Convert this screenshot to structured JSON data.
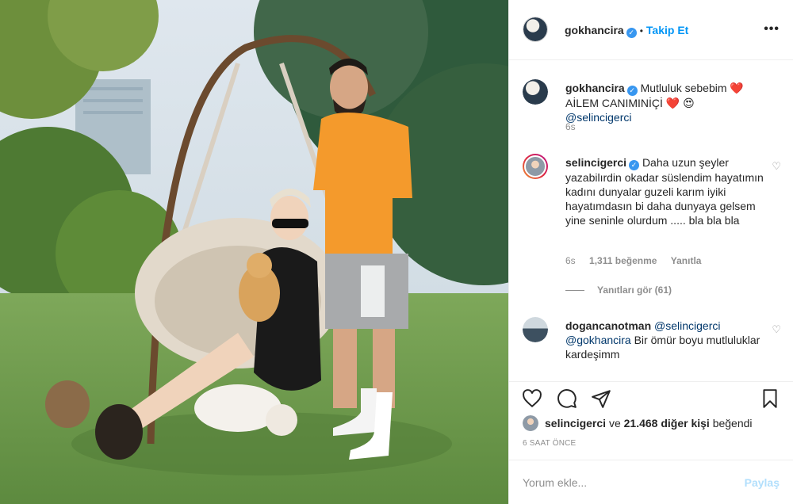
{
  "post_owner": {
    "username": "gokhancira",
    "follow_label": "Takip Et",
    "separator": "•"
  },
  "caption": {
    "username": "gokhancira",
    "text": "Mutluluk sebebim ❤️ AİLEM CANIMINİÇİ ❤️ 😍",
    "mention": "@selincigerci",
    "time": "6s"
  },
  "comments": [
    {
      "username": "selincigerci",
      "verified": true,
      "text": "Daha uzun şeyler yazabilırdin okadar süslendim hayatımın kadını dunyalar guzeli karım iyiki hayatımdasın bi daha dunyaya gelsem yine seninle olurdum ..... bla bla bla",
      "time": "6s",
      "likes": "1,311 beğenme",
      "reply": "Yanıtla",
      "view_replies": "Yanıtları gör (61)"
    },
    {
      "username": "dogancanotman",
      "verified": false,
      "mention1": "@selincigerci",
      "mention2": "@gokhancira",
      "text": "Bir ömür boyu mutluluklar kardeşimm"
    }
  ],
  "likes": {
    "user": "selincigerci",
    "connector": "ve",
    "count": "21.468 diğer kişi",
    "suffix": "beğendi"
  },
  "timestamp": "6 SAAT ÖNCE",
  "add_comment": {
    "placeholder": "Yorum ekle...",
    "post_label": "Paylaş"
  },
  "colors": {
    "accent": "#0095f6",
    "verified": "#3897f0",
    "text": "#262626",
    "muted": "#8e8e8e",
    "post_disabled": "#b2dffc"
  },
  "icons": [
    "more-options-icon",
    "heart-icon",
    "comment-icon",
    "share-icon",
    "bookmark-icon",
    "verified-badge-icon",
    "small-heart-icon"
  ]
}
